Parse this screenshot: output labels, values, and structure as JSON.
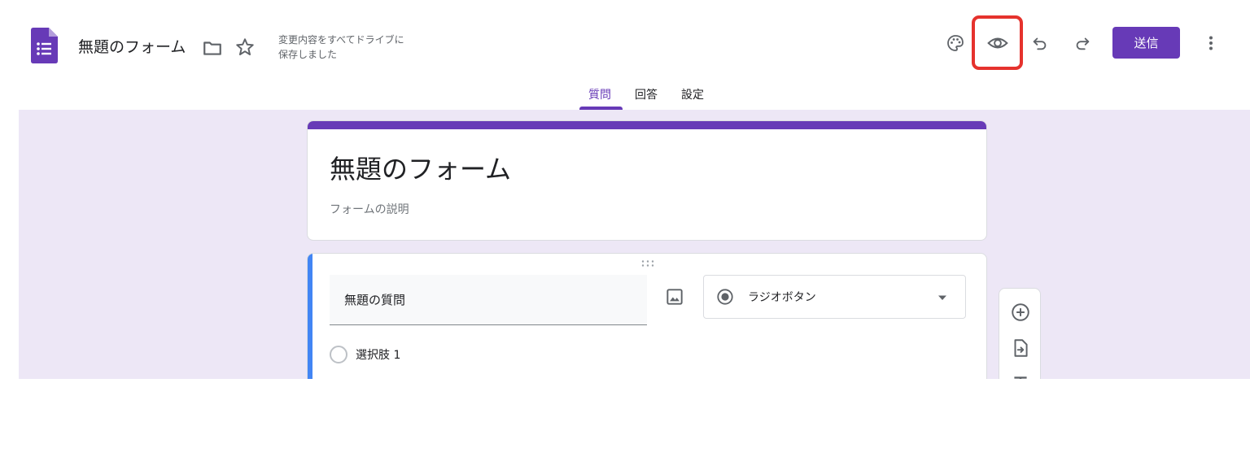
{
  "header": {
    "app_icon": "google-forms-icon",
    "doc_title": "無題のフォーム",
    "save_status_line1": "変更内容をすべてドライブに",
    "save_status_line2": "保存しました",
    "send_label": "送信",
    "icons": [
      "folder-icon",
      "star-icon",
      "palette-icon",
      "eye-icon",
      "undo-icon",
      "redo-icon",
      "more-vert-icon"
    ]
  },
  "tabs": [
    {
      "label": "質問",
      "active": true
    },
    {
      "label": "回答",
      "active": false
    },
    {
      "label": "設定",
      "active": false
    }
  ],
  "form": {
    "title": "無題のフォーム",
    "description_placeholder": "フォームの説明"
  },
  "question": {
    "title": "無題の質問",
    "type_label": "ラジオボタン",
    "options": [
      "選択肢 1"
    ]
  },
  "colors": {
    "brand_purple": "#673ab7",
    "canvas_bg": "#ede7f6",
    "active_accent": "#4285f4",
    "highlight_red": "#e5322d"
  }
}
